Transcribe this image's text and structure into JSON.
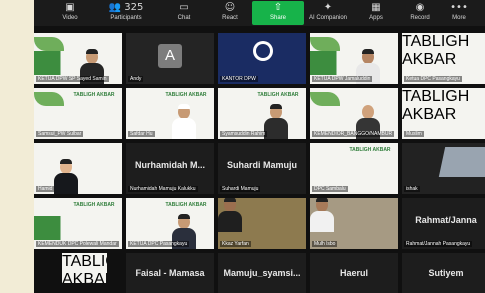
{
  "toolbar": [
    {
      "label": "Video",
      "icon": "video-icon"
    },
    {
      "label": "Participants",
      "icon": "participants-icon",
      "count": "325"
    },
    {
      "label": "Chat",
      "icon": "chat-icon"
    },
    {
      "label": "React",
      "icon": "react-icon"
    },
    {
      "label": "Share",
      "icon": "share-icon"
    },
    {
      "label": "AI Companion",
      "icon": "ai-companion-icon"
    },
    {
      "label": "Apps",
      "icon": "apps-icon"
    },
    {
      "label": "Record",
      "icon": "record-icon"
    },
    {
      "label": "More",
      "icon": "more-icon"
    }
  ],
  "slide_title": "TABLIGH AKBAR",
  "tiles": {
    "r1c1": "KETUA DPW SP Sayed Samin",
    "r1c2": "Andy",
    "r1c2_avatar": "A",
    "r1c3": "KANTOR DPW",
    "r1c4": "KETUA DPW Jamaluddin",
    "r1c5": "Ketua DPC Pasangkayu",
    "r2c1": "Samsul_PW Sulbar",
    "r2c2": "Safdar Hu",
    "r2c3": "Syamsuddin Rahim",
    "r2c4": "KEMENDIOR_BANGGO/NAMBUR",
    "r2c5": "Muslim",
    "r3c1": "Hamid",
    "r3c2_big": "Nurhamidah  M...",
    "r3c2": "Nurhamidah Mamuju Kalukku",
    "r3c3_big": "Suhardi Mamuju",
    "r3c3": "Suhardi Mamuju",
    "r3c4": "DPC Sambalu",
    "r3c5": "ishak",
    "r4c1": "KEMENDUK DPC Polewali Mandar",
    "r4c2": "KETUA DPC Pasangkayu",
    "r4c3": "Kkaz Yarfan",
    "r4c4": "Mulh lsbo",
    "r4c5_big": "Rahmat/Janna",
    "r4c5": "Rahmat/Jannah Pasangkayu",
    "r5c2_big": "Faisal - Mamasa",
    "r5c3_big": "Mamuju_syamsi...",
    "r5c4_big": "Haerul",
    "r5c5_big": "Sutiyem"
  }
}
